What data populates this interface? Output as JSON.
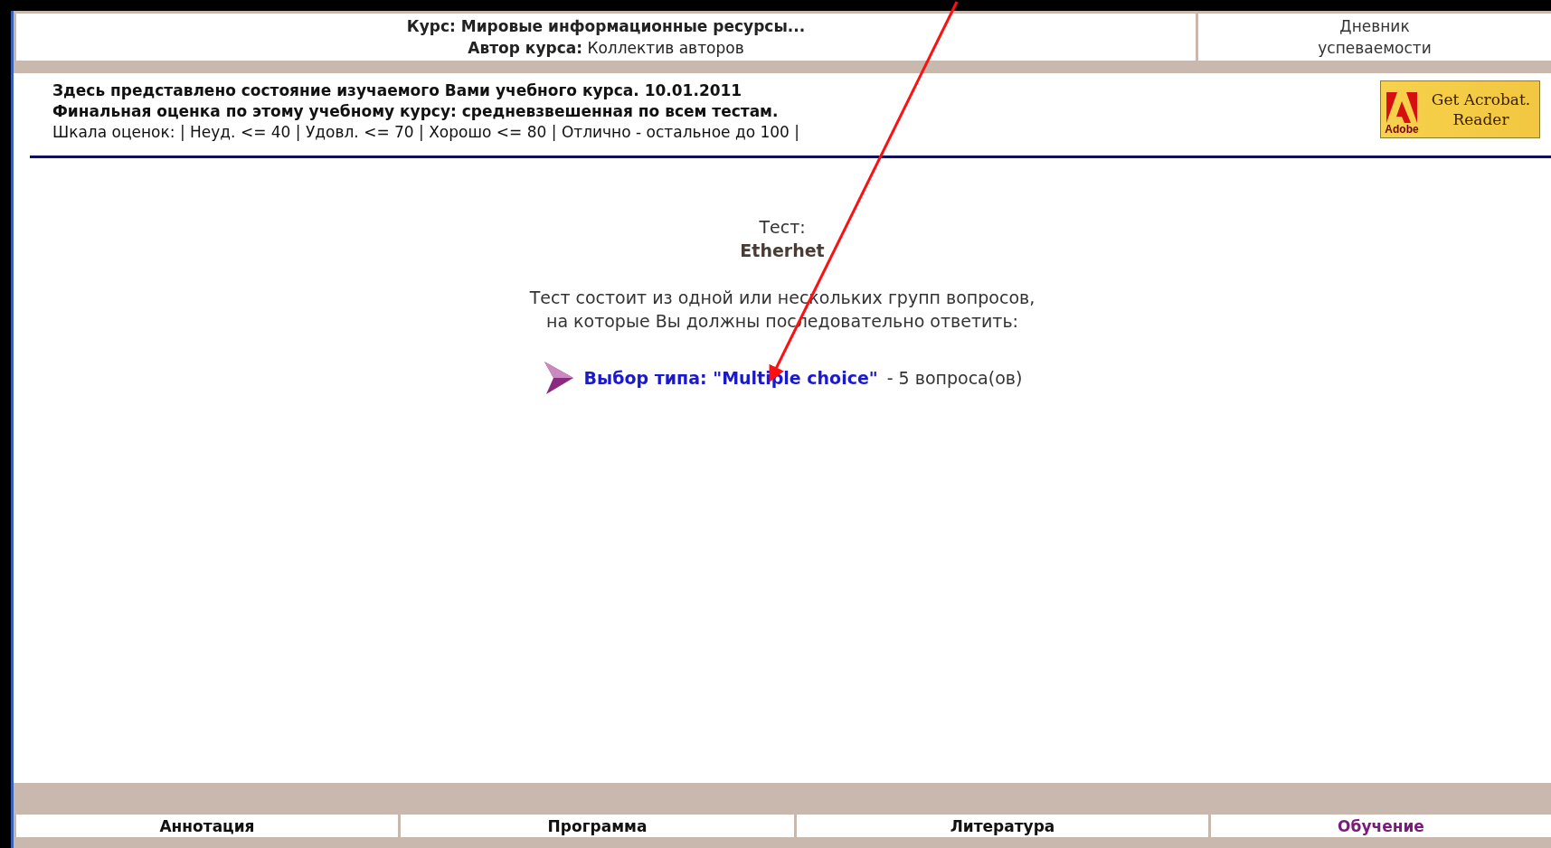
{
  "header": {
    "course_lines": [
      "**Курс:  Мировые информационные ресурсы...**",
      "**Автор курса:** Коллектив авторов"
    ],
    "diary_link": "Дневник успеваемости"
  },
  "info": {
    "lines": [
      "**Здесь представлено состояние изучаемого Вами учебного курса. 10.01.2011**",
      "**Финальная оценка по этому учебному курсу: средневзвешенная по всем тестам.**",
      "Шкала оценок: | Неуд. <= 40 | Удовл. <= 70 | Хорошо <= 80 | Отлично - остальное до 100 |"
    ],
    "acrobat_badge": {
      "line1": "Get Acrobat.",
      "line2": "Reader",
      "brand": "Adobe"
    }
  },
  "test": {
    "label": "Тест:",
    "name": "Etherhet",
    "description": [
      "Тест состоит из одной или нескольких групп вопросов,",
      "на которые Вы должны последовательно ответить:"
    ],
    "groups": [
      {
        "link": "Выбор типа: \"Multiple choice\"",
        "count": "- 5 вопроса(ов)"
      }
    ]
  },
  "nav_tabs": [
    {
      "label": "Аннотация",
      "selected": false
    },
    {
      "label": "Программа",
      "selected": false
    },
    {
      "label": "Литература",
      "selected": false
    },
    {
      "label": "Обучение",
      "selected": true
    }
  ],
  "annotation": {
    "kind": "arrow"
  }
}
